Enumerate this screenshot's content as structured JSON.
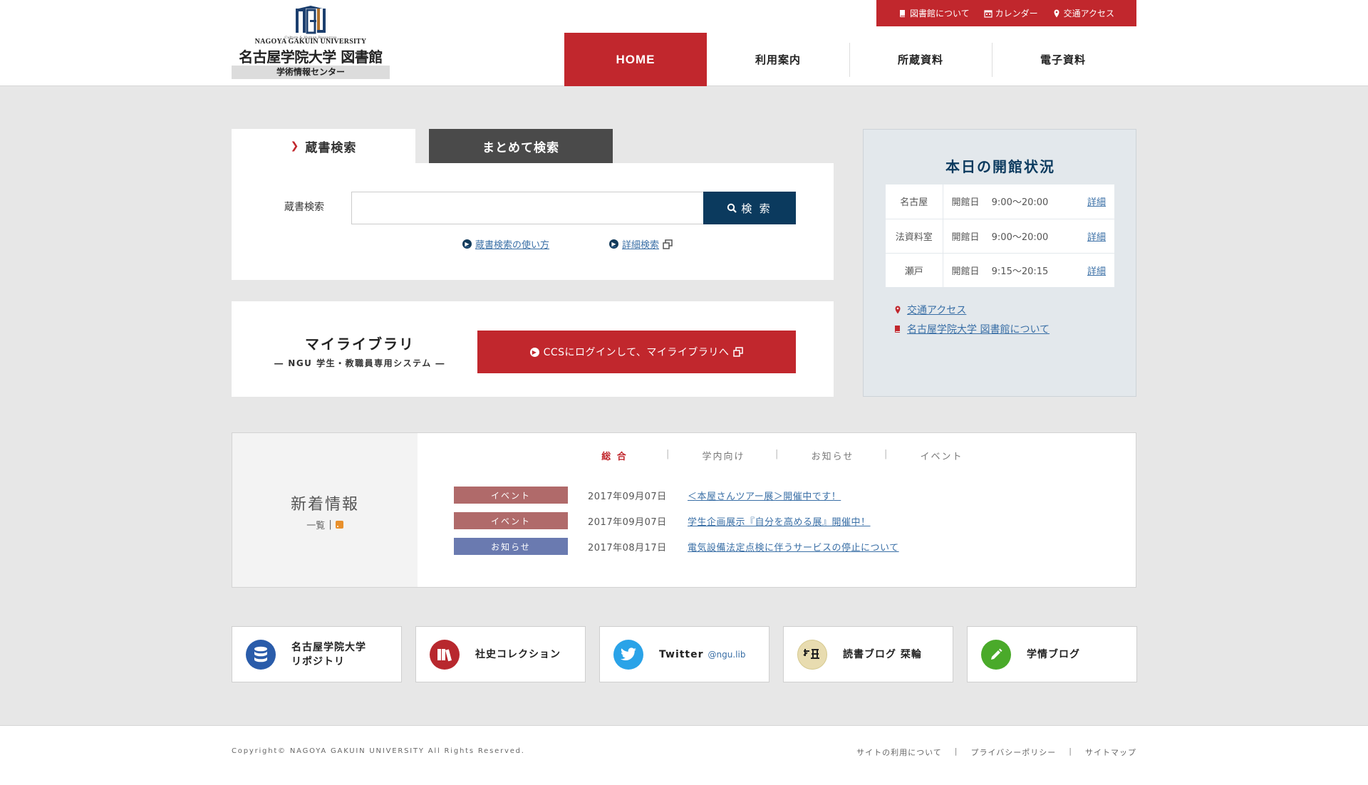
{
  "header": {
    "logo": {
      "mark": "NGU",
      "tagline": "Culture & Human Resources",
      "univ_en": "NAGOYA GAKUIN UNIVERSITY",
      "title": "名古屋学院大学 図書館",
      "subtitle": "学術情報センター"
    },
    "topbar": [
      {
        "label": "図書館について",
        "icon": "book-icon"
      },
      {
        "label": "カレンダー",
        "icon": "calendar-icon"
      },
      {
        "label": "交通アクセス",
        "icon": "map-pin-icon"
      }
    ],
    "nav": [
      "HOME",
      "利用案内",
      "所蔵資料",
      "電子資料"
    ],
    "active_nav": "HOME"
  },
  "search": {
    "tabs": [
      "蔵書検索",
      "まとめて検索"
    ],
    "label": "蔵書検索",
    "input_value": "",
    "button": "検 索",
    "links": [
      "蔵書検索の使い方",
      "詳細検索"
    ]
  },
  "mylibrary": {
    "title": "マイライブラリ",
    "subtitle": "― NGU 学生・教職員専用システム ―",
    "button": "CCSにログインして、マイライブラリへ"
  },
  "status": {
    "title": "本日の開館状況",
    "rows": [
      {
        "location": "名古屋",
        "state": "開館日",
        "hours": "9:00〜20:00",
        "detail": "詳細"
      },
      {
        "location": "法資料室",
        "state": "開館日",
        "hours": "9:00〜20:00",
        "detail": "詳細"
      },
      {
        "location": "瀬戸",
        "state": "開館日",
        "hours": "9:15〜20:15",
        "detail": "詳細"
      }
    ],
    "links": [
      "交通アクセス",
      "名古屋学院大学 図書館について"
    ]
  },
  "news": {
    "title": "新着情報",
    "more": "一覧",
    "tabs": [
      "総 合",
      "学内向け",
      "お知らせ",
      "イベント"
    ],
    "items": [
      {
        "badge": "イベント",
        "badge_color": "#b06a6a",
        "date": "2017年09月07日",
        "title": "＜本屋さんツアー展＞開催中です！"
      },
      {
        "badge": "イベント",
        "badge_color": "#b06a6a",
        "date": "2017年09月07日",
        "title": "学生企画展示『自分を高める展』開催中！"
      },
      {
        "badge": "お知らせ",
        "badge_color": "#6a7ab0",
        "date": "2017年08月17日",
        "title": "電気設備法定点検に伴うサービスの停止について"
      }
    ]
  },
  "cards": [
    {
      "label1": "名古屋学院大学",
      "label2": "リポジトリ",
      "icon": "database-icon",
      "color": "#2a5caa"
    },
    {
      "label1": "社史コレクション",
      "label2": "",
      "icon": "books-icon",
      "color": "#b8282e"
    },
    {
      "label1": "Twitter",
      "sub": "@ngu.lib",
      "icon": "twitter-icon",
      "color": "#2aa3e8"
    },
    {
      "label1": "読書ブログ 栞輪",
      "label2": "",
      "icon": "blog-logo-icon",
      "color": "#e8dcb0"
    },
    {
      "label1": "学情ブログ",
      "label2": "",
      "icon": "pencil-icon",
      "color": "#4aaa2a"
    }
  ],
  "footer": {
    "copyright": "Copyright© NAGOYA GAKUIN UNIVERSITY All Rights Reserved.",
    "links": [
      "サイトの利用について",
      "プライバシーポリシー",
      "サイトマップ"
    ]
  },
  "colors": {
    "brand_red": "#c1272d",
    "navy": "#0b3a5e",
    "link": "#3a6fa6"
  }
}
